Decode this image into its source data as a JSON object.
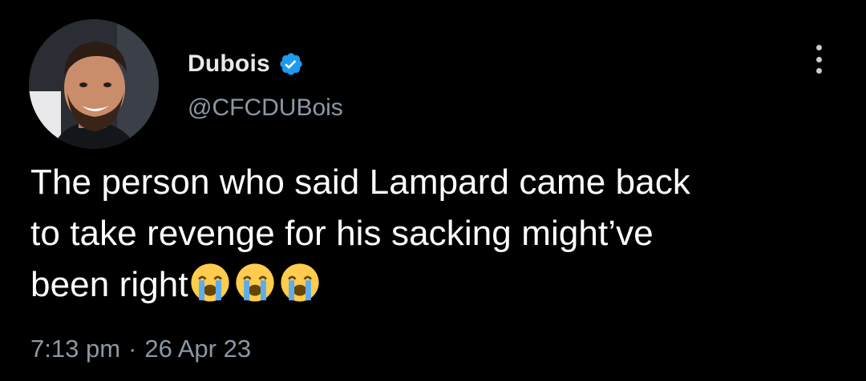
{
  "tweet": {
    "author": {
      "display_name": "Dubois",
      "handle": "@CFCDUBois",
      "verified": true
    },
    "text_lines": [
      "The person who said Lampard came back",
      "to take revenge for his sacking might’ve",
      "been right"
    ],
    "emojis": [
      "loudly-crying-face",
      "loudly-crying-face",
      "loudly-crying-face"
    ],
    "time": "7:13 pm",
    "separator": "·",
    "date": "26 Apr 23"
  },
  "colors": {
    "background": "#000000",
    "text": "#ffffff",
    "secondary_text": "#8b98a5",
    "verified_badge": "#1d9bf0",
    "emoji_face": "#ffcc4d",
    "emoji_tears": "#5dadec"
  },
  "icons": {
    "verified": "verified-badge-icon",
    "more": "more-vertical-icon"
  }
}
